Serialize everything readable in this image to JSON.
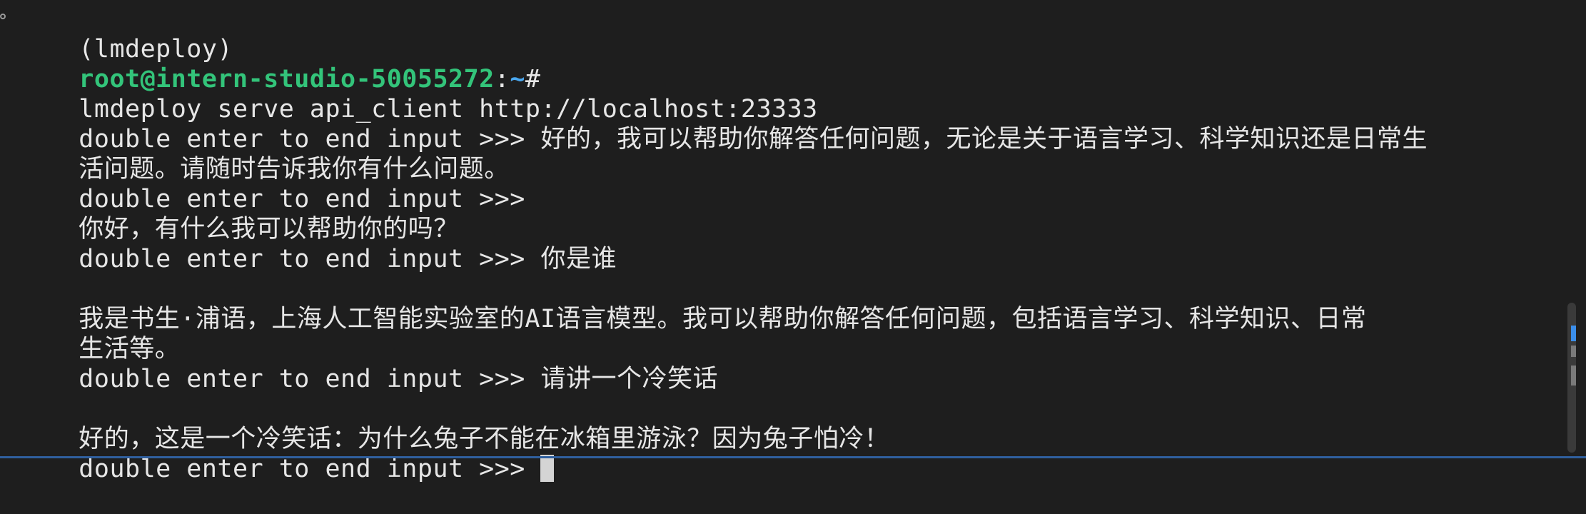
{
  "colors": {
    "background": "#1e1e1e",
    "text": "#e6e6e6",
    "user_host": "#33c47a",
    "path": "#4aa8f0",
    "cursor": "#d4d4d4",
    "scrollbar": "#3a3a3a",
    "scroll_marker": "#3b8eea"
  },
  "terminal": {
    "env": "(lmdeploy)",
    "user_host": "root@intern-studio-50055272",
    "path": "~",
    "prompt_symbol": "#",
    "command": "lmdeploy serve api_client http://localhost:23333",
    "input_prompt": "double enter to end input >>>",
    "lines": [
      {
        "type": "prompt",
        "text": " 好的，我可以帮助你解答任何问题，无论是关于语言学习、科学知识还是日常生"
      },
      {
        "type": "output",
        "text": "活问题。请随时告诉我你有什么问题。"
      },
      {
        "type": "prompt",
        "text": ""
      },
      {
        "type": "output",
        "text": "你好，有什么我可以帮助你的吗？"
      },
      {
        "type": "prompt",
        "text": " 你是谁"
      },
      {
        "type": "blank",
        "text": ""
      },
      {
        "type": "output",
        "text": "我是书生·浦语，上海人工智能实验室的AI语言模型。我可以帮助你解答任何问题，包括语言学习、科学知识、日常"
      },
      {
        "type": "output",
        "text": "生活等。"
      },
      {
        "type": "prompt",
        "text": " 请讲一个冷笑话"
      },
      {
        "type": "blank",
        "text": ""
      },
      {
        "type": "output",
        "text": "好的，这是一个冷笑话：为什么兔子不能在冰箱里游泳？因为兔子怕冷！"
      },
      {
        "type": "prompt",
        "text": " "
      }
    ]
  }
}
